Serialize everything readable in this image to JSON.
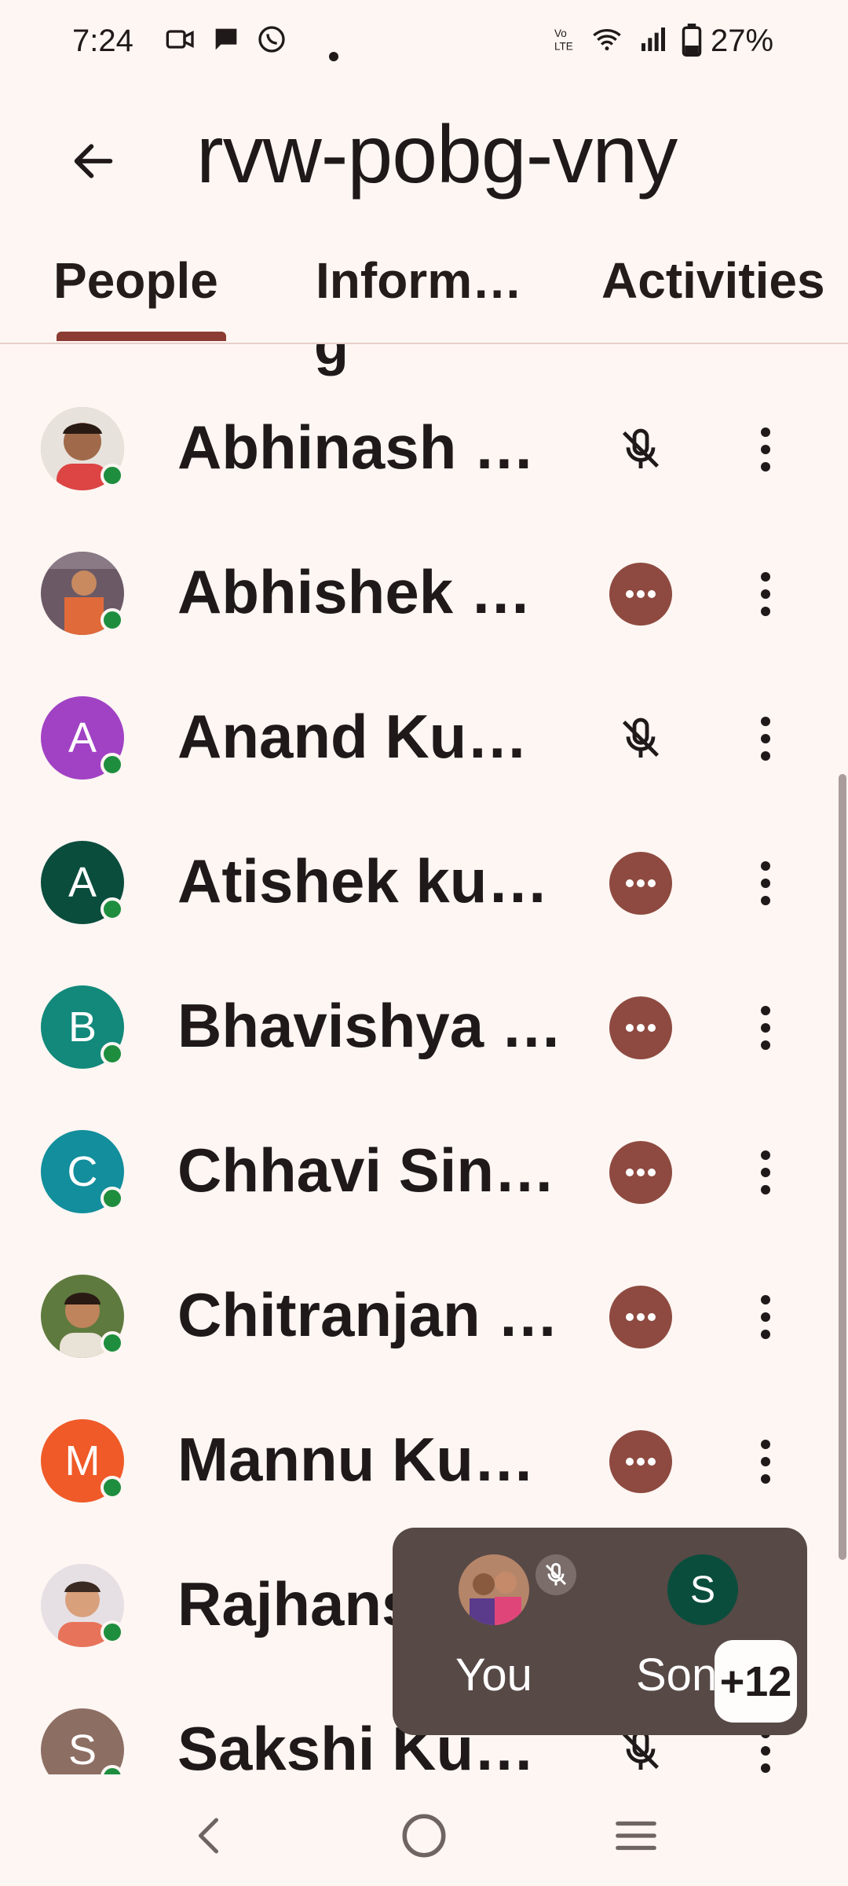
{
  "status_bar": {
    "time": "7:24",
    "battery": "27%",
    "left_icons": [
      "video-call-icon",
      "chat-bubble-icon",
      "whatsapp-icon",
      "dot-icon"
    ],
    "right_icons": [
      "volte-icon",
      "wifi-icon",
      "signal-icon",
      "battery-icon"
    ]
  },
  "header": {
    "title": "rvw-pobg-vny",
    "back_icon": "arrow-back-icon"
  },
  "tabs": [
    {
      "label": "People",
      "active": true
    },
    {
      "label": "Inform…",
      "active": false
    },
    {
      "label": "Activities",
      "active": false
    }
  ],
  "people": [
    {
      "name": "Abhinash …",
      "avatar_type": "photo",
      "status": "muted"
    },
    {
      "name": "Abhishek …",
      "avatar_type": "photo",
      "status": "speaking"
    },
    {
      "name": "Anand Ku…",
      "avatar_type": "initial",
      "initial": "A",
      "color": "#a142c4",
      "status": "muted"
    },
    {
      "name": "Atishek ku…",
      "avatar_type": "initial",
      "initial": "A",
      "color": "#0b4d3d",
      "status": "speaking"
    },
    {
      "name": "Bhavishya …",
      "avatar_type": "initial",
      "initial": "B",
      "color": "#12897a",
      "status": "speaking"
    },
    {
      "name": "Chhavi Sin…",
      "avatar_type": "initial",
      "initial": "C",
      "color": "#128e9c",
      "status": "speaking"
    },
    {
      "name": "Chitranjan …",
      "avatar_type": "photo",
      "status": "speaking"
    },
    {
      "name": "Mannu Ku…",
      "avatar_type": "initial",
      "initial": "M",
      "color": "#ef5a28",
      "status": "speaking"
    },
    {
      "name": "Rajhans",
      "avatar_type": "photo",
      "status": "hidden"
    },
    {
      "name": "Sakshi Ku…",
      "avatar_type": "initial",
      "initial": "S",
      "color": "#8d6e63",
      "status": "muted"
    }
  ],
  "pip": {
    "you_label": "You",
    "other_label": "Sonali",
    "other_initial": "S",
    "other_color": "#0b4d3d",
    "count": "+12"
  },
  "colors": {
    "accent": "#8b3c33",
    "talking_badge": "#8e4a40",
    "online": "#1e8e3e",
    "background": "#fdf6f3"
  },
  "nav": [
    "back-nav-icon",
    "home-nav-icon",
    "recents-nav-icon"
  ]
}
